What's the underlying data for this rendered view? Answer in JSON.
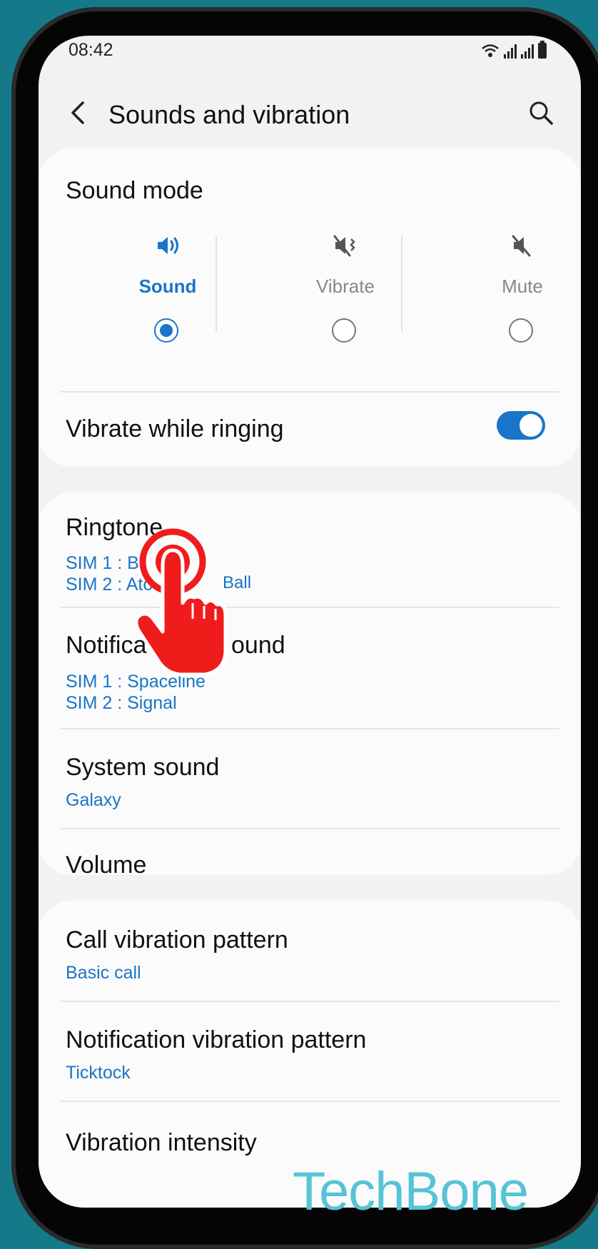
{
  "status": {
    "time": "08:42"
  },
  "header": {
    "title": "Sounds and vibration"
  },
  "sound_mode": {
    "title": "Sound mode",
    "options": [
      {
        "label": "Sound",
        "selected": true
      },
      {
        "label": "Vibrate",
        "selected": false
      },
      {
        "label": "Mute",
        "selected": false
      }
    ]
  },
  "vibrate_while_ringing": {
    "label": "Vibrate while ringing",
    "enabled": true
  },
  "ringtone": {
    "label": "Ringtone",
    "sim1": "SIM 1 : Bl",
    "sim2": "SIM 2 : Ato",
    "sim2_tail": "Ball"
  },
  "notification_sound": {
    "label": "Notifica",
    "label_tail": "ound",
    "sim1": "SIM 1 : Spaceline",
    "sim2": "SIM 2 : Signal"
  },
  "system_sound": {
    "label": "System sound",
    "value": "Galaxy"
  },
  "volume": {
    "label": "Volume"
  },
  "call_vibration": {
    "label": "Call vibration pattern",
    "value": "Basic call"
  },
  "notification_vibration": {
    "label": "Notification vibration pattern",
    "value": "Ticktock"
  },
  "vibration_intensity": {
    "label": "Vibration intensity"
  },
  "watermark": {
    "text": "TechBone"
  },
  "colors": {
    "accent": "#1a74c8",
    "background": "#147a8a",
    "tap_indicator": "#f01c1c",
    "watermark": "#57c3d6"
  }
}
